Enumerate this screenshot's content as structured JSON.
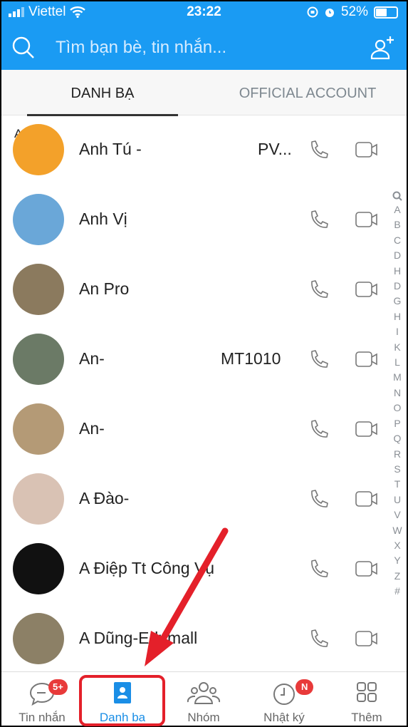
{
  "status_bar": {
    "carrier": "Viettel",
    "time": "23:22",
    "battery": "52%",
    "battery_level": 0.52
  },
  "search": {
    "placeholder": "Tìm bạn bè, tin nhắn..."
  },
  "tabs": [
    {
      "label": "DANH BẠ",
      "active": true
    },
    {
      "label": "OFFICIAL ACCOUNT",
      "active": false
    }
  ],
  "section_letter": "A",
  "contacts": [
    {
      "name": "Anh Tú -",
      "suffix": "PV...",
      "avatar_color": "#f3a12a"
    },
    {
      "name": "Anh Vị",
      "suffix": "",
      "avatar_color": "#6aa7d8"
    },
    {
      "name": "An Pro",
      "suffix": "",
      "avatar_color": "#8b7a5e"
    },
    {
      "name": "An-",
      "suffix": "MT1010",
      "avatar_color": "#6b7a66"
    },
    {
      "name": "An-",
      "suffix": "",
      "avatar_color": "#b49a76"
    },
    {
      "name": "A Đào-",
      "suffix": "",
      "avatar_color": "#d9c2b4"
    },
    {
      "name": "A Điệp Tt Công Vụ",
      "suffix": "",
      "avatar_color": "#111111"
    },
    {
      "name": "A Dũng-Edumall",
      "suffix": "",
      "avatar_color": "#8c8066"
    }
  ],
  "index_letters": [
    "A",
    "B",
    "C",
    "D",
    "H",
    "D",
    "G",
    "H",
    "I",
    "K",
    "L",
    "M",
    "N",
    "O",
    "P",
    "Q",
    "R",
    "S",
    "T",
    "U",
    "V",
    "W",
    "X",
    "Y",
    "Z",
    "#"
  ],
  "bottom_nav": [
    {
      "label": "Tin nhắn",
      "badge": "5+"
    },
    {
      "label": "Danh ba",
      "active": true
    },
    {
      "label": "Nhóm"
    },
    {
      "label": "Nhật ký",
      "badge": "N"
    },
    {
      "label": "Thêm"
    }
  ],
  "colors": {
    "brand": "#1a9bf3",
    "highlight": "#e4202a",
    "badge": "#e83a3a"
  }
}
